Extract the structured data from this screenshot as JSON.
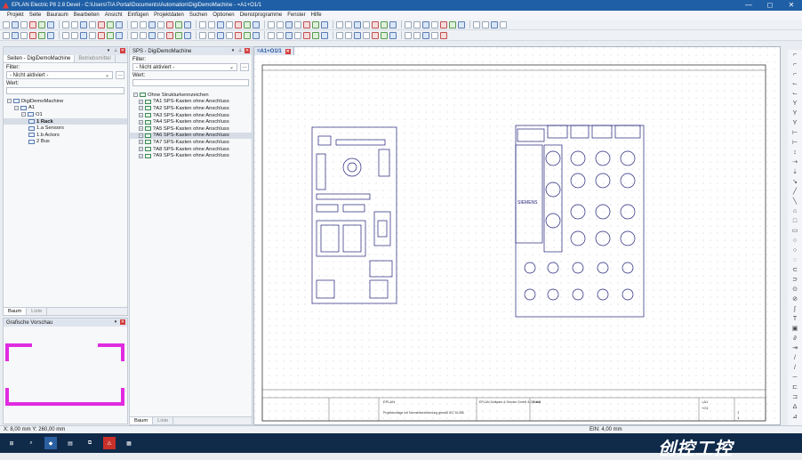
{
  "window": {
    "title": "EPLAN Electric P8 2.8 Devel - C:\\Users\\TIA Portal\\Documents\\Automation\\DigiDemoMachine - =A1+O1/1",
    "controls": [
      "—",
      "◻",
      "✕"
    ]
  },
  "menu": [
    "Projekt",
    "Seite",
    "Bauraum",
    "Bearbeiten",
    "Ansicht",
    "Einfügen",
    "Projektdaten",
    "Suchen",
    "Optionen",
    "Dienstprogramme",
    "Fenster",
    "Hilfe"
  ],
  "pages_panel": {
    "title": "",
    "tabs": [
      "Seiten - DigiDemoMachine",
      "Betriebsmittel"
    ],
    "filter_label": "Filter:",
    "filter_value": "- Nicht aktiviert -",
    "value_label": "Wert:",
    "tree": [
      {
        "label": "DigiDemoMachine",
        "depth": 0
      },
      {
        "label": "A1",
        "depth": 1
      },
      {
        "label": "O1",
        "depth": 2
      },
      {
        "label": "1 Rack",
        "depth": 3,
        "selected": true
      },
      {
        "label": "1.a Sensors",
        "depth": 3
      },
      {
        "label": "1.b Actors",
        "depth": 3
      },
      {
        "label": "2 Bus",
        "depth": 3
      }
    ],
    "bottom_tabs": [
      "Baum",
      "Liste"
    ]
  },
  "preview_panel": {
    "title": "Grafische Vorschau"
  },
  "sps_panel": {
    "title": "SPS - DigiDemoMachine",
    "filter_label": "Filter:",
    "filter_value": "- Nicht aktiviert -",
    "value_label": "Wert:",
    "root": "Ohne Strukturkennzeichen",
    "items": [
      "?A1 SPS-Kasten ohne Anschluss",
      "?A2 SPS-Kasten ohne Anschluss",
      "?A3 SPS-Kasten ohne Anschluss",
      "?A4 SPS-Kasten ohne Anschluss",
      "?A5 SPS-Kasten ohne Anschluss",
      "?A6 SPS-Kasten ohne Anschluss",
      "?A7 SPS-Kasten ohne Anschluss",
      "?A8 SPS-Kasten ohne Anschluss",
      "?A9 SPS-Kasten ohne Anschluss"
    ],
    "selected_index": 5,
    "bottom_tabs": [
      "Baum",
      "Liste"
    ]
  },
  "document": {
    "tab": "=A1+O1/1",
    "close": "✕",
    "titleblock": {
      "company": "EPLAN Software & Service GmbH & Co. KG",
      "desc": "Rack",
      "project": "EPLAN",
      "subtitle": "Projektvorlage mit Normenbezeichnung gemäß IEC 61355",
      "page": "=A1",
      "page_field": "+O1",
      "sheet": "1",
      "sheets": "1"
    },
    "device_label": "SIEMENS"
  },
  "status": {
    "coords": "X: 8,00 mm   Y: 260,00 mm",
    "zoom": "EIN: 4,00 mm"
  },
  "taskbar": [
    "windows-icon",
    "search-icon",
    "eplan-icon",
    "files-icon",
    "sps-icon",
    "warning-icon",
    "tia-icon"
  ],
  "watermark": "创控工控",
  "colors": {
    "title": "#1f5fa6",
    "preview": "#e02be0",
    "close": "#d23c3c",
    "taskbar": "#102a4a"
  }
}
